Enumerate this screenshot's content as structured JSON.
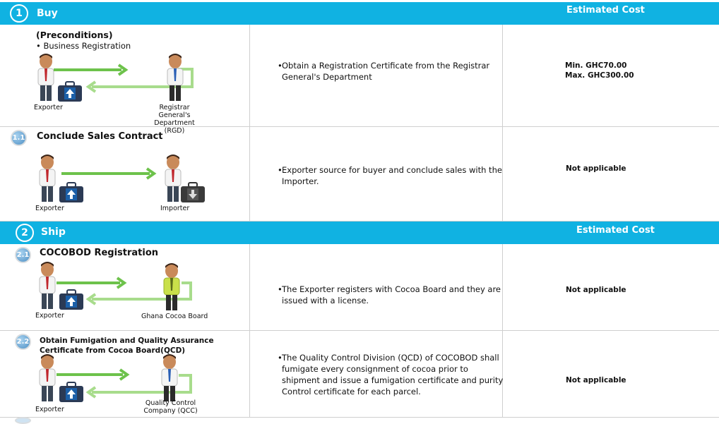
{
  "section1": {
    "number": "1",
    "title": "Buy",
    "cost_header": "Estimated Cost",
    "pre": {
      "title": "(Preconditions)",
      "item": "• Business Registration",
      "from": "Exporter",
      "to": "Registrar General's Department (RGD)",
      "desc": "Obtain a Registration Certificate from the Registrar General's Department",
      "cost_min": "Min. GHC70.00",
      "cost_max": "Max. GHC300.00"
    },
    "step": {
      "badge": "1.1",
      "title": "Conclude Sales Contract",
      "from": "Exporter",
      "to": "Importer",
      "desc": "Exporter source for buyer and conclude sales with the Importer.",
      "cost": "Not applicable"
    }
  },
  "section2": {
    "number": "2",
    "title": "Ship",
    "cost_header": "Estimated Cost",
    "steps": [
      {
        "badge": "2.1",
        "title": "COCOBOD Registration",
        "from": "Exporter",
        "to": "Ghana Cocoa Board",
        "desc": "The Exporter registers with Cocoa Board and they are issued with a license.",
        "cost": "Not applicable"
      },
      {
        "badge": "2.2",
        "title": "Obtain Fumigation and  Quality  Assurance Certificate from Cocoa Board(QCD)",
        "from": "Exporter",
        "to": "Quality Control Company (QCC)",
        "desc": "The Quality Control Division (QCD) of COCOBOD shall fumigate every consignment of cocoa prior to shipment and issue a fumigation certificate and purity Control certificate for each parcel.",
        "cost": "Not applicable"
      }
    ]
  },
  "colors": {
    "band": "#10b2e2",
    "arrow": "#6dc24b",
    "arrow_light": "#a8dc8c"
  }
}
